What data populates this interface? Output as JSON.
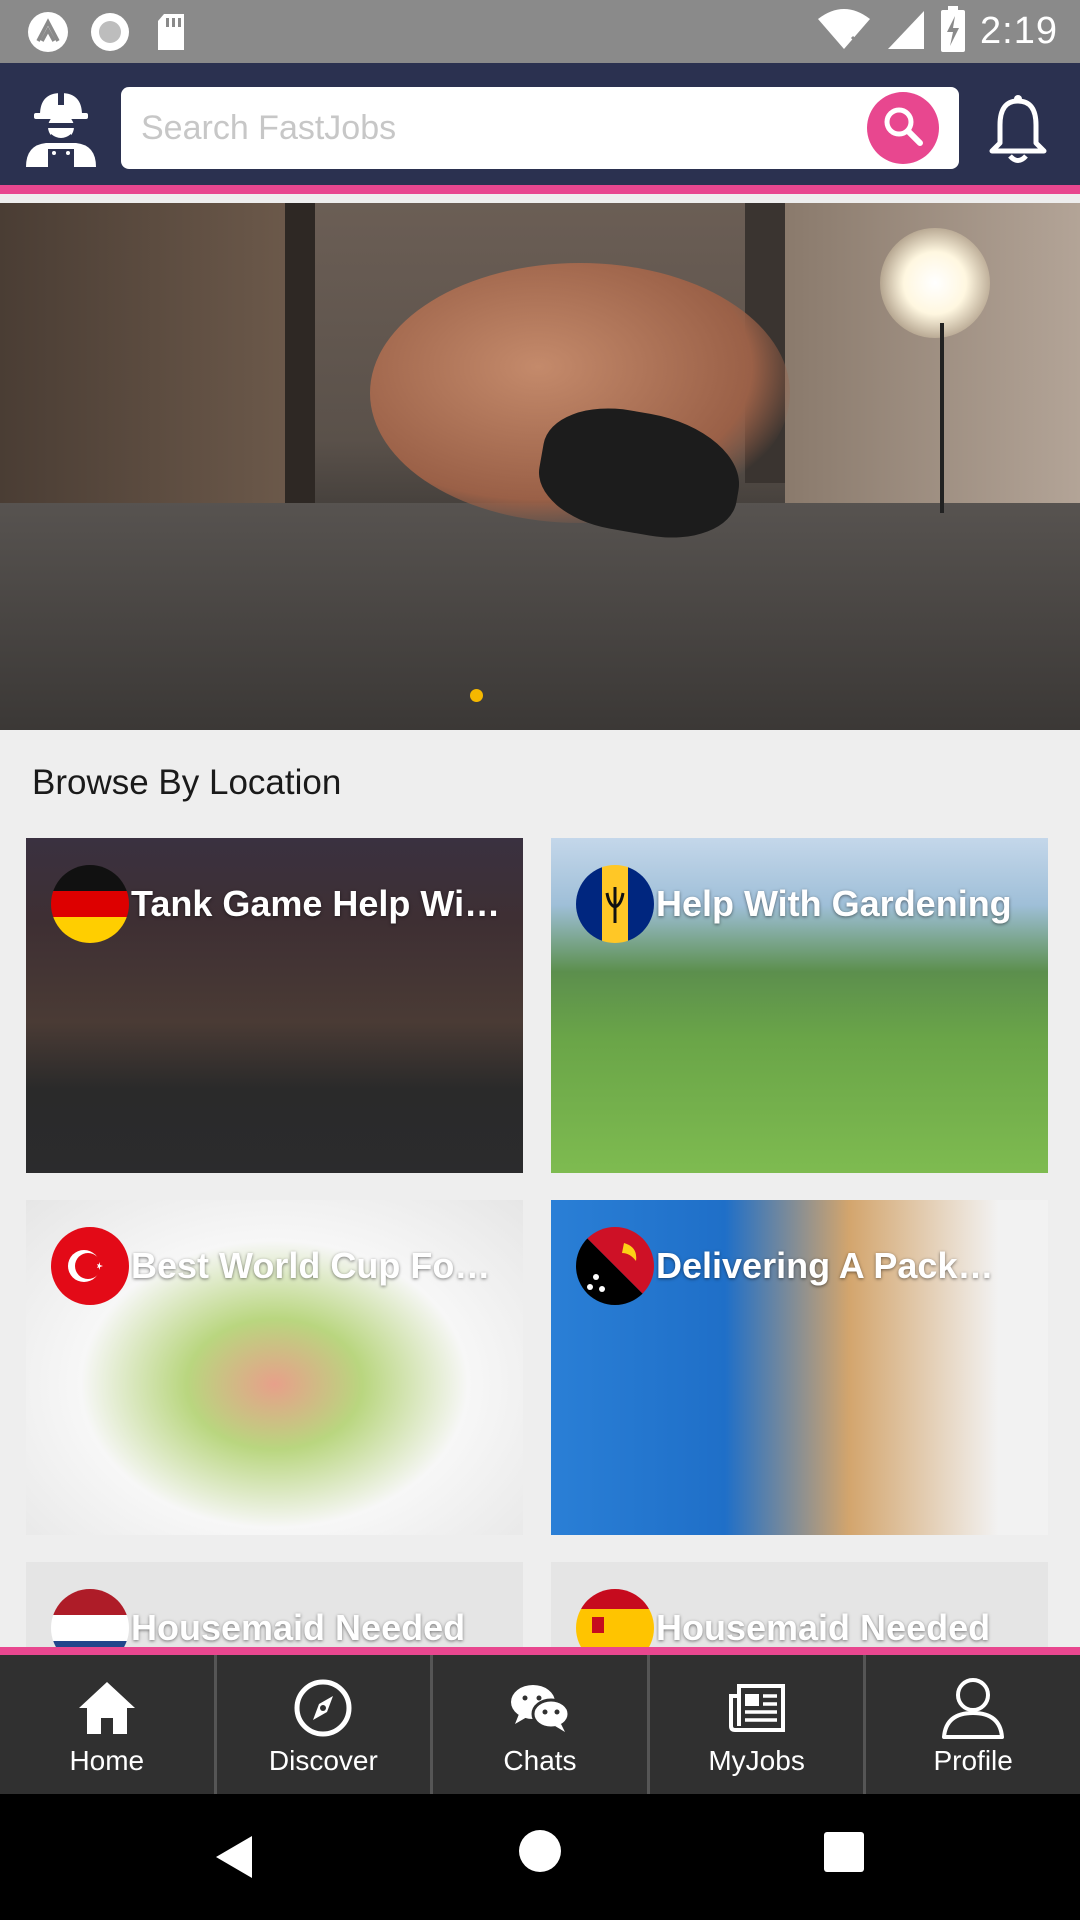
{
  "status_bar": {
    "time": "2:19",
    "left_icons": [
      "app-a-icon",
      "record-icon",
      "sd-card-icon"
    ],
    "right_icons": [
      "wifi-off-icon",
      "signal-icon",
      "battery-charging-icon"
    ]
  },
  "header": {
    "logo_icon": "worker-logo-icon",
    "search_placeholder": "Search FastJobs",
    "search_icon": "search-icon",
    "notification_icon": "bell-icon",
    "colors": {
      "background": "#2b3150",
      "accent": "#e8478f"
    }
  },
  "hero": {
    "image": "fitness-man-dumbbell-pushup-photo",
    "carousel_dots": 1,
    "active_dot_color": "#f5b800"
  },
  "browse": {
    "title": "Browse By Location",
    "cards": [
      {
        "title": "Tank Game Help Wit…",
        "flag": "germany-flag",
        "image": "night-street-bridge-photo"
      },
      {
        "title": "Help With Gardening",
        "flag": "barbados-flag",
        "image": "park-lawn-photo"
      },
      {
        "title": "Best World Cup Foo…",
        "flag": "turkey-flag",
        "image": "shrimp-salad-photo"
      },
      {
        "title": "Delivering A Pack…",
        "flag": "papua-new-guinea-flag",
        "image": "parcel-delivery-photo"
      },
      {
        "title": "Housemaid Needed",
        "flag": "netherlands-flag",
        "image": "housemaid-photo"
      },
      {
        "title": "Housemaid Needed",
        "flag": "spain-flag",
        "image": "housemaid-photo"
      }
    ]
  },
  "bottom_nav": [
    {
      "label": "Home",
      "icon": "home-icon"
    },
    {
      "label": "Discover",
      "icon": "compass-icon"
    },
    {
      "label": "Chats",
      "icon": "chat-bubbles-icon"
    },
    {
      "label": "MyJobs",
      "icon": "newspaper-icon"
    },
    {
      "label": "Profile",
      "icon": "user-icon"
    }
  ],
  "system_nav": [
    "back-icon",
    "home-circle-icon",
    "recents-icon"
  ]
}
